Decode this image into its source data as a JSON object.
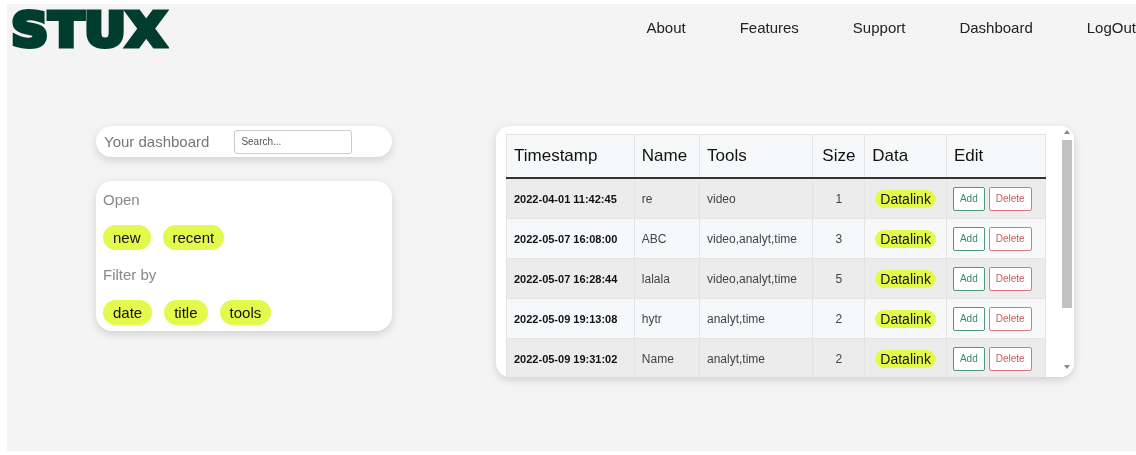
{
  "logo": "STUX",
  "nav": [
    {
      "label": "About"
    },
    {
      "label": "Features"
    },
    {
      "label": "Support"
    },
    {
      "label": "Dashboard"
    },
    {
      "label": "LogOut"
    }
  ],
  "dashboard": {
    "title": "Your dashboard",
    "search": {
      "placeholder": "Search..."
    }
  },
  "filters": [
    {
      "heading": "Open",
      "chips": [
        "new",
        "recent"
      ]
    },
    {
      "heading": "Filter by",
      "chips": [
        "date",
        "title",
        "tools"
      ]
    }
  ],
  "table": {
    "columns": [
      "Timestamp",
      "Name",
      "Tools",
      "Size",
      "Data",
      "Edit"
    ],
    "rows": [
      {
        "timestamp": "2022-04-01 11:42:45",
        "name": "re",
        "tools": "video",
        "size": "1",
        "data": "Datalink",
        "add": "Add",
        "delete": "Delete"
      },
      {
        "timestamp": "2022-05-07 16:08:00",
        "name": "ABC",
        "tools": "video,analyt,time",
        "size": "3",
        "data": "Datalink",
        "add": "Add",
        "delete": "Delete"
      },
      {
        "timestamp": "2022-05-07 16:28:44",
        "name": "lalala",
        "tools": "video,analyt,time",
        "size": "5",
        "data": "Datalink",
        "add": "Add",
        "delete": "Delete"
      },
      {
        "timestamp": "2022-05-09 19:13:08",
        "name": "hytr",
        "tools": "analyt,time",
        "size": "2",
        "data": "Datalink",
        "add": "Add",
        "delete": "Delete"
      },
      {
        "timestamp": "2022-05-09 19:31:02",
        "name": "Name",
        "tools": "analyt,time",
        "size": "2",
        "data": "Datalink",
        "add": "Add",
        "delete": "Delete"
      }
    ]
  }
}
